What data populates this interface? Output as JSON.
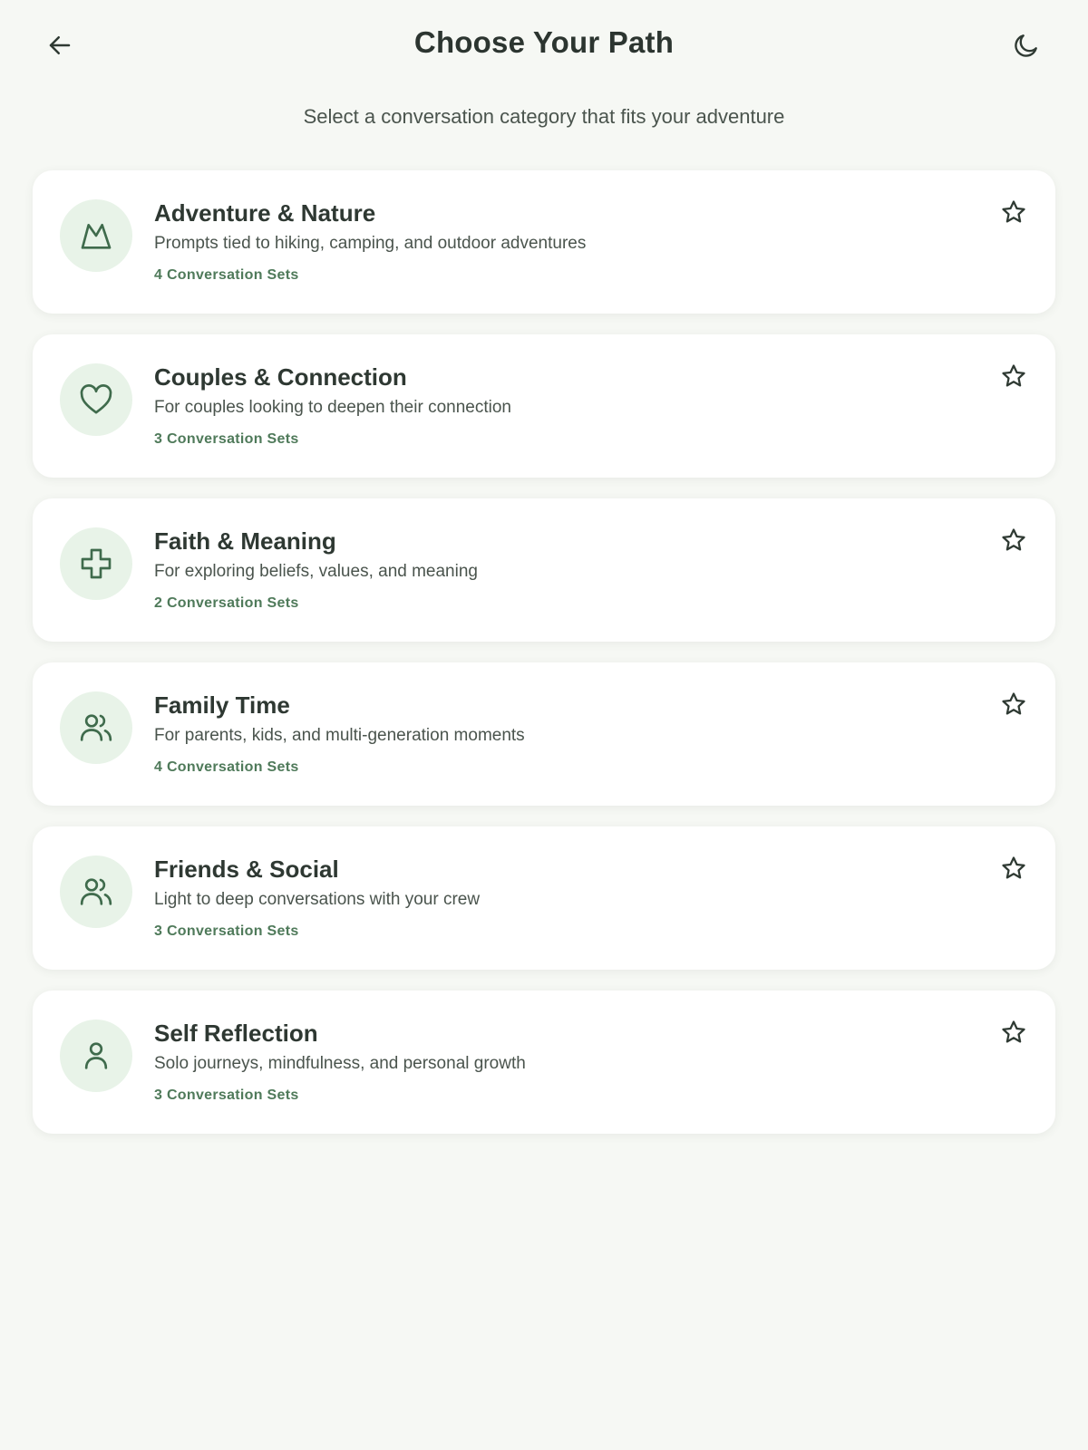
{
  "header": {
    "title": "Choose Your Path",
    "subtitle": "Select a conversation category that fits your adventure"
  },
  "categories": [
    {
      "title": "Adventure & Nature",
      "description": "Prompts tied to hiking, camping, and outdoor adventures",
      "count": "4 Conversation Sets",
      "icon": "mountain-icon"
    },
    {
      "title": "Couples & Connection",
      "description": "For couples looking to deepen their connection",
      "count": "3 Conversation Sets",
      "icon": "heart-icon"
    },
    {
      "title": "Faith & Meaning",
      "description": "For exploring beliefs, values, and meaning",
      "count": "2 Conversation Sets",
      "icon": "cross-icon"
    },
    {
      "title": "Family Time",
      "description": "For parents, kids, and multi-generation moments",
      "count": "4 Conversation Sets",
      "icon": "users-icon"
    },
    {
      "title": "Friends & Social",
      "description": "Light to deep conversations with your crew",
      "count": "3 Conversation Sets",
      "icon": "users-icon"
    },
    {
      "title": "Self Reflection",
      "description": "Solo journeys, mindfulness, and personal growth",
      "count": "3 Conversation Sets",
      "icon": "user-icon"
    }
  ],
  "colors": {
    "background": "#f6f8f4",
    "card": "#ffffff",
    "icon_bg": "#e8f3e8",
    "icon_stroke": "#3f6b4c",
    "count_text": "#4f7a5a"
  }
}
